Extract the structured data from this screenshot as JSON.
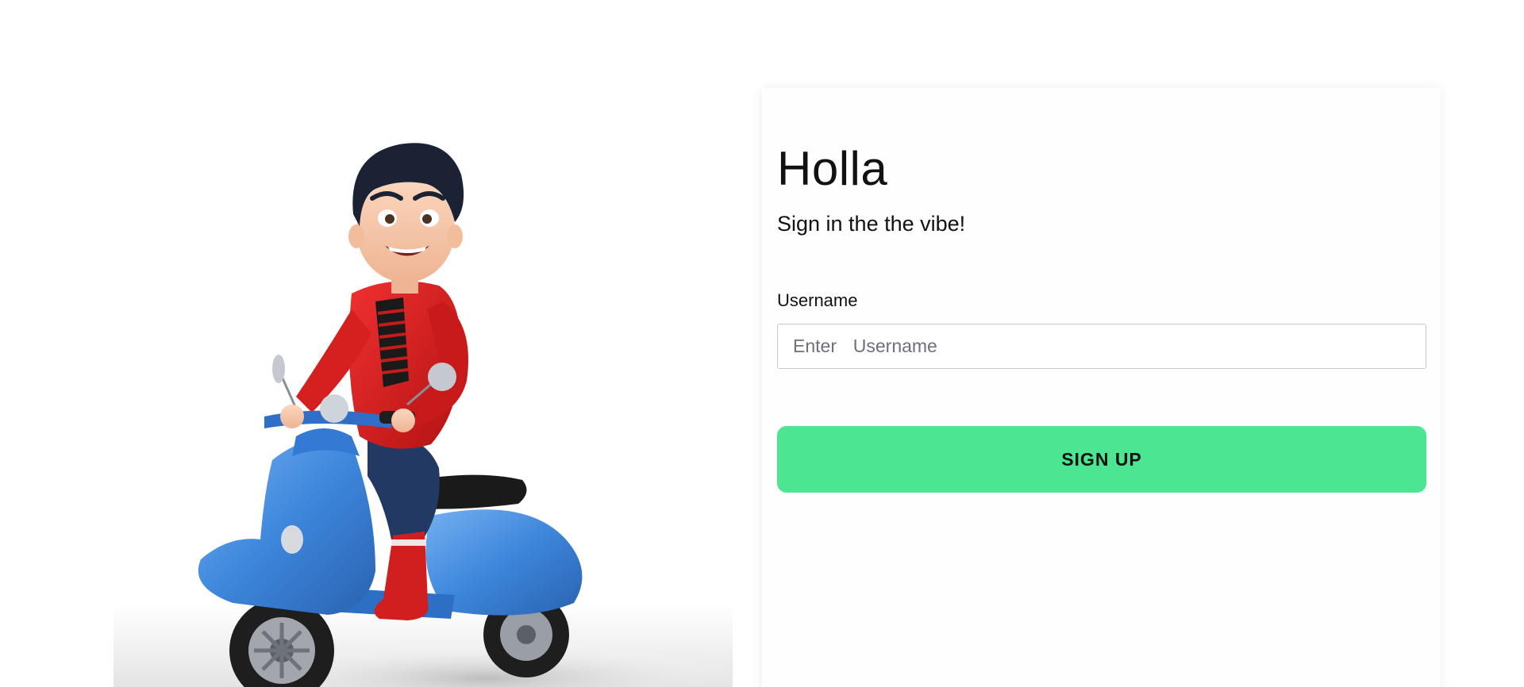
{
  "hero": {
    "illustration": "cartoon-boy-riding-blue-scooter"
  },
  "form": {
    "title": "Holla",
    "subtitle": "Sign in the the vibe!",
    "username_label": "Username",
    "username_placeholder": "Enter  Username",
    "username_value": "",
    "submit_label": "SIGN UP"
  },
  "colors": {
    "button": "#4ce693",
    "scooter": "#3d86db",
    "jacket": "#d91c1c",
    "background": "#ffffff"
  }
}
